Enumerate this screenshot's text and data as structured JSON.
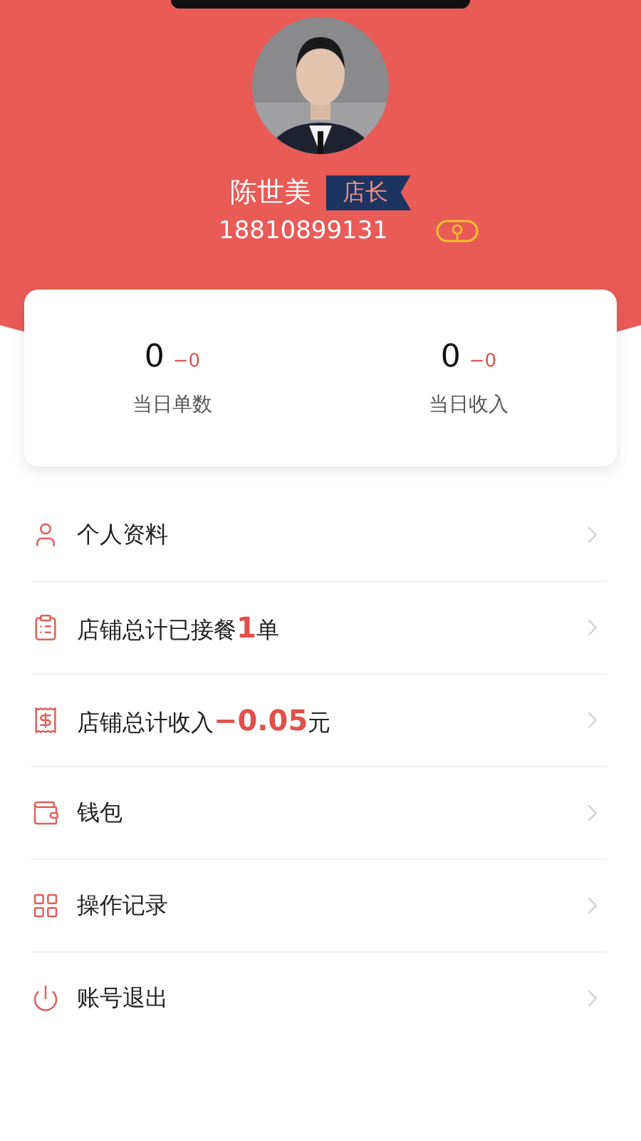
{
  "profile": {
    "name": "陈世美",
    "role_badge": "店长",
    "phone": "18810899131"
  },
  "stats": [
    {
      "value": "0",
      "delta": "−0",
      "label": "当日单数"
    },
    {
      "value": "0",
      "delta": "−0",
      "label": "当日收入"
    }
  ],
  "menu": [
    {
      "kind": "person",
      "label": "个人资料"
    },
    {
      "kind": "clipboard",
      "label": "店铺总计已接餐**1**单"
    },
    {
      "kind": "receipt",
      "label": "店铺总计收入**−0.05**元"
    },
    {
      "kind": "wallet",
      "label": "钱包"
    },
    {
      "kind": "grid",
      "label": "操作记录"
    },
    {
      "kind": "power",
      "label": "账号退出"
    }
  ]
}
